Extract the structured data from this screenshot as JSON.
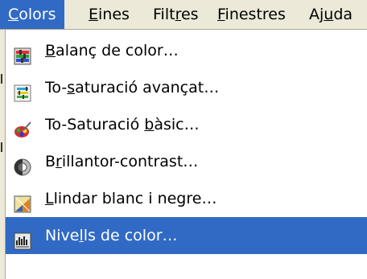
{
  "menubar": {
    "items": [
      {
        "pre": "",
        "key": "C",
        "post": "olors",
        "active": true
      },
      {
        "pre": "",
        "key": "E",
        "post": "ines",
        "active": false
      },
      {
        "pre": "Filt",
        "key": "r",
        "post": "es",
        "active": false
      },
      {
        "pre": "",
        "key": "F",
        "post": "inestres",
        "active": false
      },
      {
        "pre": "Aj",
        "key": "u",
        "post": "da",
        "active": false
      }
    ]
  },
  "menu": {
    "items": [
      {
        "pre": "",
        "key": "B",
        "post": "alanç de color…",
        "icon": "color-balance-icon",
        "highlighted": false
      },
      {
        "pre": "To-",
        "key": "s",
        "post": "aturació avançat…",
        "icon": "hue-saturation-advanced-icon",
        "highlighted": false
      },
      {
        "pre": "To-Saturació ",
        "key": "b",
        "post": "àsic…",
        "icon": "hue-saturation-basic-icon",
        "highlighted": false
      },
      {
        "pre": "B",
        "key": "r",
        "post": "illantor-contrast…",
        "icon": "brightness-contrast-icon",
        "highlighted": false
      },
      {
        "pre": "",
        "key": "L",
        "post": "lindar blanc i negre…",
        "icon": "threshold-icon",
        "highlighted": false
      },
      {
        "pre": "Nive",
        "key": "l",
        "post": "ls de color…",
        "icon": "levels-icon",
        "highlighted": true
      }
    ]
  },
  "colors": {
    "highlight": "#316ac5",
    "menubar_bg": "#ece9d8",
    "menu_bg": "#ffffff"
  }
}
